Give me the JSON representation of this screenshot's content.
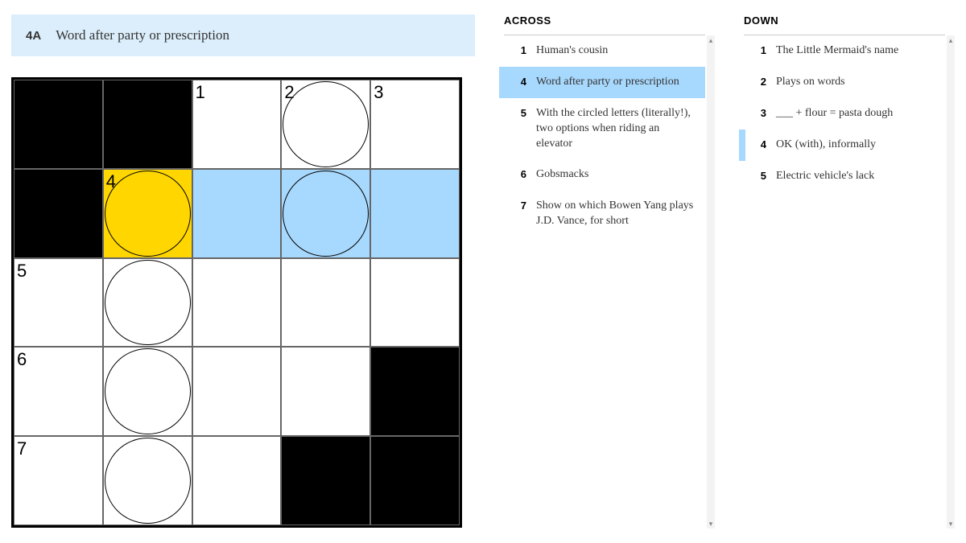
{
  "banner": {
    "number": "4A",
    "text": "Word after party or prescription"
  },
  "grid": {
    "size": 5,
    "cells": [
      [
        {
          "black": true
        },
        {
          "black": true
        },
        {
          "num": "1"
        },
        {
          "num": "2",
          "circle": true
        },
        {
          "num": "3"
        }
      ],
      [
        {
          "black": true
        },
        {
          "num": "4",
          "circle": true,
          "state": "active"
        },
        {
          "state": "hl"
        },
        {
          "circle": true,
          "state": "hl"
        },
        {
          "state": "hl"
        }
      ],
      [
        {
          "num": "5"
        },
        {
          "circle": true
        },
        {},
        {},
        {}
      ],
      [
        {
          "num": "6"
        },
        {
          "circle": true
        },
        {},
        {},
        {
          "black": true
        }
      ],
      [
        {
          "num": "7"
        },
        {
          "circle": true
        },
        {},
        {
          "black": true
        },
        {
          "black": true
        }
      ]
    ]
  },
  "across": {
    "heading": "ACROSS",
    "clues": [
      {
        "n": "1",
        "t": "Human's cousin"
      },
      {
        "n": "4",
        "t": "Word after party or prescription",
        "selected": true
      },
      {
        "n": "5",
        "t": "With the circled letters (literally!), two options when riding an elevator"
      },
      {
        "n": "6",
        "t": "Gobsmacks"
      },
      {
        "n": "7",
        "t": "Show on which Bowen Yang plays J.D. Vance, for short"
      }
    ]
  },
  "down": {
    "heading": "DOWN",
    "clues": [
      {
        "n": "1",
        "t": "The Little Mermaid's name"
      },
      {
        "n": "2",
        "t": "Plays on words"
      },
      {
        "n": "3",
        "t": "___ + flour = pasta dough"
      },
      {
        "n": "4",
        "t": "OK (with), informally",
        "related": true
      },
      {
        "n": "5",
        "t": "Electric vehicle's lack"
      }
    ]
  }
}
